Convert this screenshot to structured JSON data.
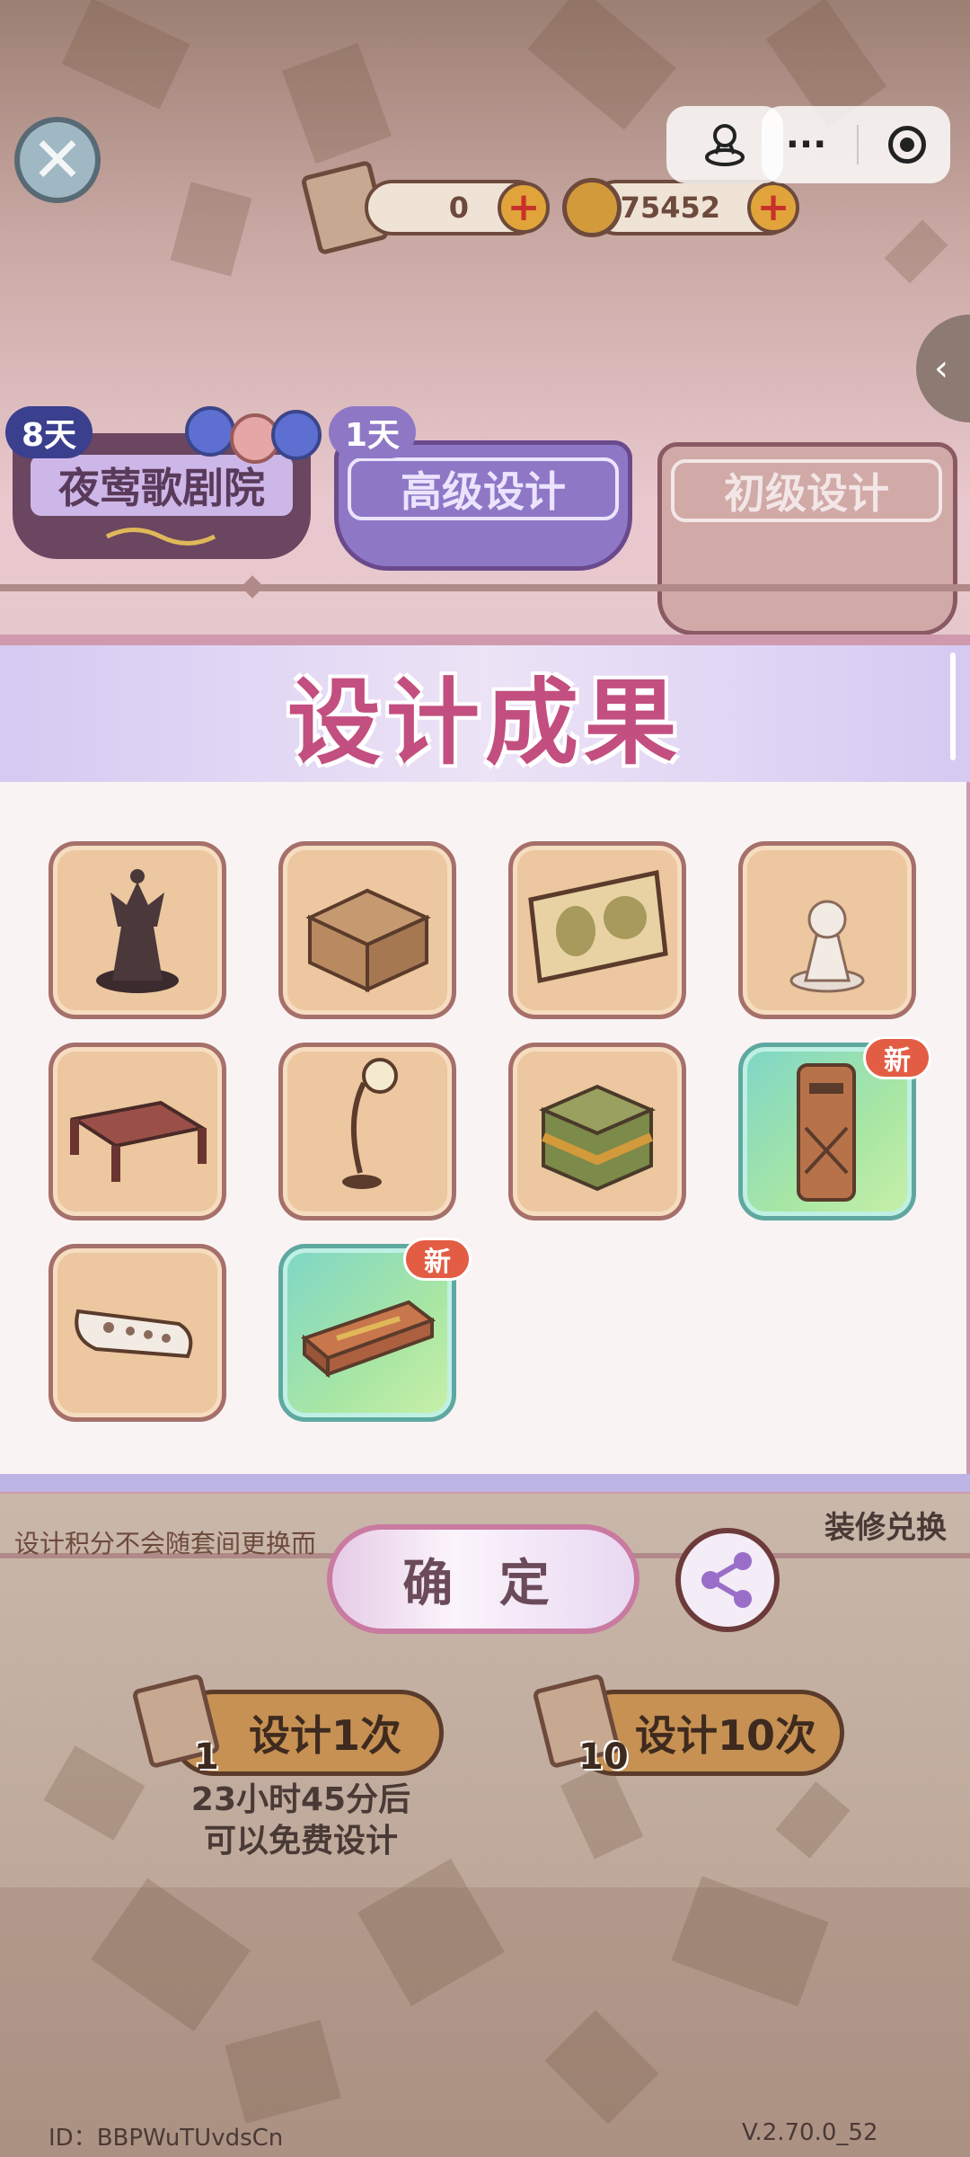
{
  "currencies": {
    "scrolls": "0",
    "coins": "675452"
  },
  "tabs": [
    {
      "label": "夜莺歌剧院",
      "badge": "8天"
    },
    {
      "label": "高级设计",
      "badge": "1天"
    },
    {
      "label": "初级设计",
      "badge": ""
    }
  ],
  "modal": {
    "title": "设计成果",
    "new_label": "新",
    "items": [
      {
        "name": "black-queen-chess-piece",
        "new": false
      },
      {
        "name": "cardboard-box",
        "new": false
      },
      {
        "name": "world-map-scroll",
        "new": false
      },
      {
        "name": "white-pawn-chess-piece",
        "new": false
      },
      {
        "name": "low-coffee-table",
        "new": false
      },
      {
        "name": "floor-lamp",
        "new": false
      },
      {
        "name": "stacked-blocks",
        "new": false
      },
      {
        "name": "mailbox-post",
        "new": true
      },
      {
        "name": "remote-control",
        "new": false
      },
      {
        "name": "wooden-crate-box",
        "new": true
      }
    ]
  },
  "notice": "设计积分不会随套间更换而",
  "exchange_link": "装修兑换",
  "confirm_label": "确 定",
  "design_once": {
    "label": "设计1次",
    "cost": "1"
  },
  "design_ten": {
    "label": "设计10次",
    "cost": "10"
  },
  "free_notice_line1": "23小时45分后",
  "free_notice_line2": "可以免费设计",
  "footer": {
    "id": "ID：BBPWuTUvdsCn",
    "version": "V.2.70.0_52"
  },
  "colors": {
    "accent_pink": "#c24f7f",
    "badge_new": "#e35d45",
    "button_gold": "#c69153"
  }
}
